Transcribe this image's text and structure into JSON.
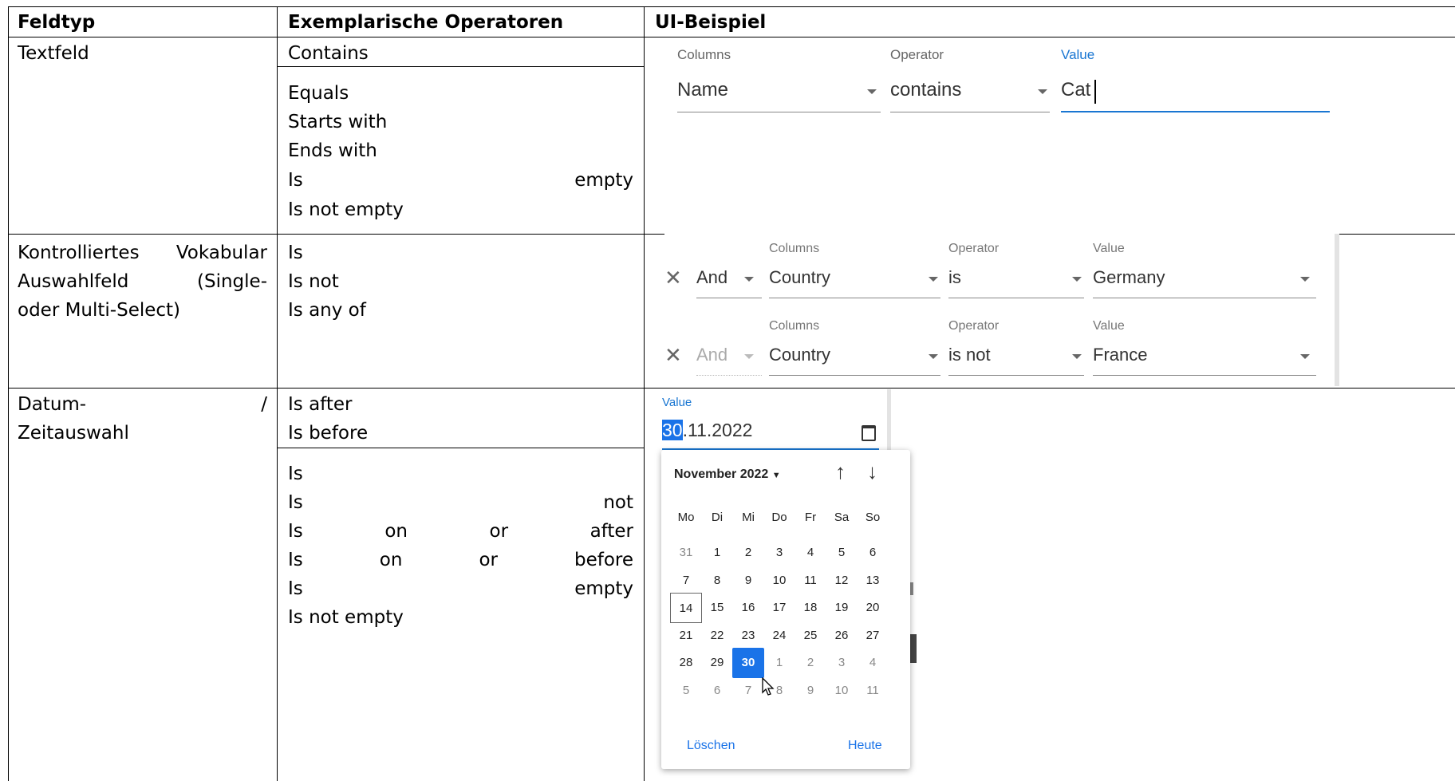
{
  "table": {
    "headers": [
      "Feldtyp",
      "Exemplarische Operatoren",
      "UI-Beispiel"
    ],
    "row1": {
      "feldtyp": "Textfeld",
      "op_main": "Contains",
      "op_list": [
        "Equals",
        "Starts with",
        "Ends with"
      ],
      "op_is": "Is",
      "op_empty": "empty",
      "op_last": "Is not empty"
    },
    "row2": {
      "feldtyp_line1_a": "Kontrolliertes",
      "feldtyp_line1_b": "Vokabular",
      "feldtyp_line2_a": "Auswahlfeld",
      "feldtyp_line2_b": "(Single-",
      "feldtyp_line3": "oder Multi-Select)",
      "ops": [
        "Is",
        "Is not",
        "Is any of"
      ]
    },
    "row3": {
      "feldtyp_line1_a": "Datum-",
      "feldtyp_line1_b": "/",
      "feldtyp_line2": "Zeitauswahl",
      "op_main": [
        "Is after",
        "Is before"
      ],
      "op_is": "Is",
      "op_not": "not",
      "op_on": "on",
      "op_or": "or",
      "op_after": "after",
      "op_before": "before",
      "op_empty": "empty",
      "op_last": "Is not empty"
    }
  },
  "ui1": {
    "columns_label": "Columns",
    "operator_label": "Operator",
    "value_label": "Value",
    "columns_value": "Name",
    "operator_value": "contains",
    "value_value": "Cat"
  },
  "ui2": {
    "rows": [
      {
        "logic": "And",
        "columns_label": "Columns",
        "operator_label": "Operator",
        "value_label": "Value",
        "column": "Country",
        "operator": "is",
        "value": "Germany"
      },
      {
        "logic": "And",
        "columns_label": "Columns",
        "operator_label": "Operator",
        "value_label": "Value",
        "column": "Country",
        "operator": "is not",
        "value": "France"
      }
    ]
  },
  "ui3": {
    "value_label": "Value",
    "date_selected": "30",
    "date_rest": ".11.2022",
    "month_label": "November 2022",
    "weekdays": [
      "Mo",
      "Di",
      "Mi",
      "Do",
      "Fr",
      "Sa",
      "So"
    ],
    "weeks": [
      [
        "31",
        "1",
        "2",
        "3",
        "4",
        "5",
        "6"
      ],
      [
        "7",
        "8",
        "9",
        "10",
        "11",
        "12",
        "13"
      ],
      [
        "14",
        "15",
        "16",
        "17",
        "18",
        "19",
        "20"
      ],
      [
        "21",
        "22",
        "23",
        "24",
        "25",
        "26",
        "27"
      ],
      [
        "28",
        "29",
        "30",
        "1",
        "2",
        "3",
        "4"
      ],
      [
        "5",
        "6",
        "7",
        "8",
        "9",
        "10",
        "11"
      ]
    ],
    "clear_label": "Löschen",
    "today_label": "Heute"
  }
}
